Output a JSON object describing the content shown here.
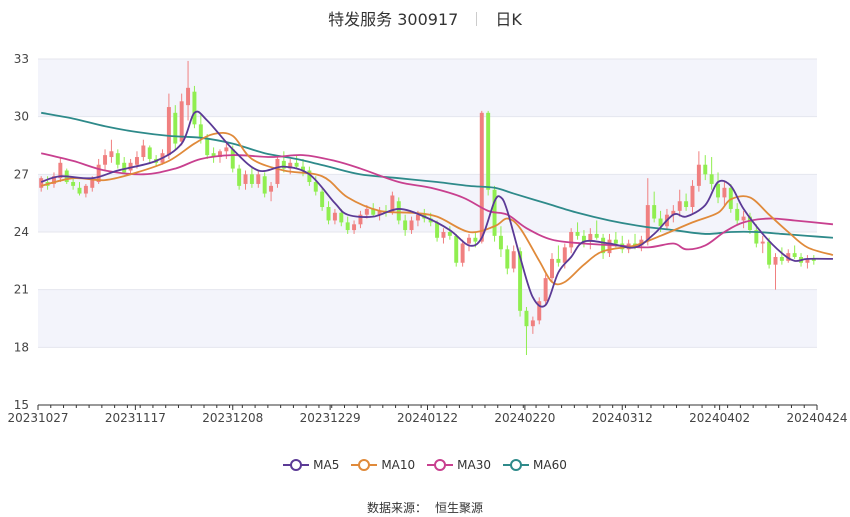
{
  "header": {
    "title": "特发服务 300917",
    "period": "日K"
  },
  "source": {
    "label": "数据来源：",
    "value": "恒生聚源"
  },
  "chart_data": {
    "type": "candlestick",
    "ylim": [
      15,
      33
    ],
    "yticks": [
      15,
      18,
      21,
      24,
      27,
      30,
      33
    ],
    "grid": true,
    "up_color": "#f08080",
    "down_color": "#90ee50",
    "x_tick_labels": [
      "20231027",
      "20231117",
      "20231208",
      "20231229",
      "20240122",
      "20240220",
      "20240312",
      "20240402",
      "20240424"
    ],
    "legend": [
      {
        "name": "MA5",
        "color": "#5b3a96"
      },
      {
        "name": "MA10",
        "color": "#e08a3a"
      },
      {
        "name": "MA30",
        "color": "#c8408f"
      },
      {
        "name": "MA60",
        "color": "#2e8a8a"
      }
    ],
    "ohlc": [
      [
        26.3,
        26.9,
        26.1,
        26.8
      ],
      [
        26.6,
        26.9,
        26.2,
        26.4
      ],
      [
        26.5,
        27.1,
        26.3,
        26.9
      ],
      [
        26.8,
        27.9,
        26.6,
        27.6
      ],
      [
        27.2,
        27.3,
        26.5,
        26.6
      ],
      [
        26.6,
        26.8,
        26.2,
        26.4
      ],
      [
        26.3,
        26.6,
        25.9,
        26.0
      ],
      [
        26.0,
        26.5,
        25.8,
        26.4
      ],
      [
        26.3,
        26.9,
        26.1,
        26.7
      ],
      [
        26.6,
        27.8,
        26.5,
        27.5
      ],
      [
        27.5,
        28.3,
        27.2,
        28.0
      ],
      [
        27.9,
        28.8,
        27.6,
        28.2
      ],
      [
        28.1,
        28.3,
        27.3,
        27.5
      ],
      [
        27.6,
        27.9,
        27.0,
        27.1
      ],
      [
        27.2,
        27.8,
        27.0,
        27.6
      ],
      [
        27.5,
        28.2,
        27.3,
        27.9
      ],
      [
        27.9,
        28.8,
        27.7,
        28.5
      ],
      [
        28.4,
        28.5,
        27.6,
        27.8
      ],
      [
        27.8,
        28.0,
        27.4,
        27.6
      ],
      [
        27.6,
        28.3,
        27.5,
        28.1
      ],
      [
        28.0,
        31.2,
        27.8,
        30.5
      ],
      [
        30.2,
        30.6,
        28.3,
        28.6
      ],
      [
        28.7,
        31.2,
        28.5,
        30.8
      ],
      [
        30.6,
        32.9,
        29.8,
        31.5
      ],
      [
        31.3,
        31.6,
        29.4,
        29.6
      ],
      [
        29.6,
        30.1,
        28.6,
        28.9
      ],
      [
        28.9,
        29.1,
        27.8,
        28.0
      ],
      [
        28.1,
        28.4,
        27.6,
        27.9
      ],
      [
        27.9,
        28.3,
        27.6,
        28.2
      ],
      [
        28.2,
        28.6,
        27.8,
        28.4
      ],
      [
        28.3,
        28.5,
        27.1,
        27.3
      ],
      [
        27.3,
        27.5,
        26.2,
        26.4
      ],
      [
        26.5,
        27.2,
        26.2,
        27.0
      ],
      [
        27.0,
        27.4,
        26.3,
        26.5
      ],
      [
        26.5,
        27.2,
        26.3,
        27.0
      ],
      [
        26.9,
        27.1,
        25.8,
        26.0
      ],
      [
        26.1,
        26.6,
        25.6,
        26.4
      ],
      [
        26.5,
        28.0,
        26.3,
        27.8
      ],
      [
        27.7,
        28.2,
        27.1,
        27.3
      ],
      [
        27.3,
        27.8,
        27.0,
        27.6
      ],
      [
        27.6,
        28.0,
        27.3,
        27.4
      ],
      [
        27.4,
        27.8,
        26.9,
        27.2
      ],
      [
        27.2,
        27.4,
        26.4,
        26.6
      ],
      [
        26.6,
        26.9,
        25.9,
        26.1
      ],
      [
        26.1,
        26.3,
        25.1,
        25.3
      ],
      [
        25.3,
        25.6,
        24.4,
        24.6
      ],
      [
        24.6,
        25.2,
        24.4,
        25.0
      ],
      [
        25.0,
        25.2,
        24.3,
        24.5
      ],
      [
        24.5,
        24.8,
        23.9,
        24.1
      ],
      [
        24.1,
        24.6,
        23.9,
        24.4
      ],
      [
        24.4,
        25.1,
        24.2,
        24.9
      ],
      [
        24.9,
        25.4,
        24.7,
        25.2
      ],
      [
        25.2,
        25.5,
        24.8,
        24.9
      ],
      [
        24.9,
        25.3,
        24.6,
        25.1
      ],
      [
        25.1,
        25.4,
        24.8,
        25.0
      ],
      [
        25.0,
        26.1,
        24.9,
        25.9
      ],
      [
        25.6,
        25.8,
        24.4,
        24.6
      ],
      [
        24.6,
        24.9,
        23.8,
        24.1
      ],
      [
        24.1,
        24.8,
        23.9,
        24.6
      ],
      [
        24.6,
        25.1,
        24.3,
        24.9
      ],
      [
        24.9,
        25.2,
        24.5,
        24.7
      ],
      [
        24.7,
        25.0,
        24.3,
        24.5
      ],
      [
        24.5,
        24.6,
        23.5,
        23.7
      ],
      [
        23.7,
        24.2,
        23.4,
        24.0
      ],
      [
        24.0,
        24.3,
        23.6,
        23.8
      ],
      [
        23.8,
        23.9,
        22.2,
        22.4
      ],
      [
        22.4,
        23.6,
        22.2,
        23.4
      ],
      [
        23.4,
        23.9,
        23.0,
        23.7
      ],
      [
        23.7,
        24.0,
        23.2,
        23.5
      ],
      [
        23.5,
        30.3,
        23.4,
        30.2
      ],
      [
        30.2,
        30.3,
        25.9,
        26.2
      ],
      [
        26.2,
        26.4,
        23.5,
        23.8
      ],
      [
        23.8,
        24.3,
        22.7,
        23.1
      ],
      [
        23.1,
        23.3,
        21.8,
        22.1
      ],
      [
        22.1,
        23.3,
        21.9,
        23.0
      ],
      [
        23.0,
        23.2,
        19.6,
        19.9
      ],
      [
        19.9,
        20.1,
        17.6,
        19.1
      ],
      [
        19.1,
        19.6,
        18.7,
        19.4
      ],
      [
        19.4,
        20.6,
        19.2,
        20.4
      ],
      [
        20.4,
        21.8,
        20.2,
        21.6
      ],
      [
        21.6,
        22.9,
        21.4,
        22.6
      ],
      [
        22.6,
        23.3,
        22.2,
        22.4
      ],
      [
        22.4,
        23.4,
        22.1,
        23.2
      ],
      [
        23.2,
        24.2,
        22.9,
        24.0
      ],
      [
        24.0,
        24.5,
        23.6,
        23.8
      ],
      [
        23.8,
        24.1,
        23.2,
        23.5
      ],
      [
        23.5,
        24.2,
        23.1,
        23.9
      ],
      [
        23.9,
        24.6,
        23.6,
        23.7
      ],
      [
        23.7,
        23.9,
        22.6,
        22.9
      ],
      [
        22.9,
        23.9,
        22.7,
        23.6
      ],
      [
        23.6,
        24.0,
        23.2,
        23.4
      ],
      [
        23.4,
        23.8,
        22.9,
        23.1
      ],
      [
        23.1,
        23.6,
        22.9,
        23.4
      ],
      [
        23.4,
        23.9,
        23.1,
        23.3
      ],
      [
        23.3,
        23.8,
        23.0,
        23.6
      ],
      [
        23.6,
        26.8,
        23.3,
        25.4
      ],
      [
        25.4,
        26.1,
        24.5,
        24.7
      ],
      [
        24.7,
        25.1,
        24.0,
        24.3
      ],
      [
        24.3,
        25.2,
        24.1,
        24.9
      ],
      [
        24.9,
        25.4,
        24.5,
        25.1
      ],
      [
        25.1,
        26.2,
        24.8,
        25.6
      ],
      [
        25.6,
        26.0,
        25.1,
        25.3
      ],
      [
        25.3,
        26.7,
        25.0,
        26.4
      ],
      [
        26.4,
        28.2,
        26.1,
        27.5
      ],
      [
        27.5,
        28.0,
        26.7,
        27.0
      ],
      [
        27.0,
        27.9,
        26.2,
        26.5
      ],
      [
        26.5,
        27.1,
        25.5,
        25.8
      ],
      [
        25.8,
        26.6,
        25.4,
        26.3
      ],
      [
        26.3,
        26.5,
        25.0,
        25.2
      ],
      [
        25.2,
        25.5,
        24.4,
        24.6
      ],
      [
        24.6,
        25.1,
        24.2,
        24.8
      ],
      [
        24.8,
        25.0,
        23.9,
        24.1
      ],
      [
        24.1,
        24.4,
        23.2,
        23.4
      ],
      [
        23.4,
        23.8,
        22.9,
        23.5
      ],
      [
        23.5,
        23.7,
        22.1,
        22.3
      ],
      [
        22.3,
        22.9,
        21.0,
        22.7
      ],
      [
        22.7,
        23.2,
        22.3,
        22.5
      ],
      [
        22.5,
        23.1,
        22.4,
        22.9
      ],
      [
        22.9,
        23.3,
        22.6,
        22.7
      ],
      [
        22.7,
        22.9,
        22.2,
        22.4
      ],
      [
        22.4,
        22.8,
        22.1,
        22.6
      ],
      [
        22.6,
        22.8,
        22.3,
        22.5
      ]
    ],
    "ma": {
      "MA5": [
        [
          0,
          26.6
        ],
        [
          3,
          26.9
        ],
        [
          8,
          26.8
        ],
        [
          12,
          27.2
        ],
        [
          18,
          27.7
        ],
        [
          22,
          28.6
        ],
        [
          24,
          30.2
        ],
        [
          26,
          29.8
        ],
        [
          30,
          28.3
        ],
        [
          34,
          27.2
        ],
        [
          38,
          27.4
        ],
        [
          42,
          27.0
        ],
        [
          46,
          25.5
        ],
        [
          48,
          24.9
        ],
        [
          52,
          24.8
        ],
        [
          56,
          25.2
        ],
        [
          60,
          24.8
        ],
        [
          64,
          24.1
        ],
        [
          67,
          23.3
        ],
        [
          69,
          23.7
        ],
        [
          71,
          25.6
        ],
        [
          72,
          25.8
        ],
        [
          73,
          25.1
        ],
        [
          75,
          22.7
        ],
        [
          77,
          20.6
        ],
        [
          79,
          20.2
        ],
        [
          81,
          21.9
        ],
        [
          83,
          22.7
        ],
        [
          85,
          23.5
        ],
        [
          89,
          23.4
        ],
        [
          93,
          23.2
        ],
        [
          96,
          23.9
        ],
        [
          99,
          24.9
        ],
        [
          101,
          24.8
        ],
        [
          104,
          25.4
        ],
        [
          106,
          26.6
        ],
        [
          108,
          26.4
        ],
        [
          110,
          25.2
        ],
        [
          113,
          23.9
        ],
        [
          116,
          22.9
        ],
        [
          118,
          22.5
        ],
        [
          120,
          22.6
        ],
        [
          124,
          22.6
        ]
      ],
      "MA10": [
        [
          0,
          26.4
        ],
        [
          5,
          26.8
        ],
        [
          10,
          26.7
        ],
        [
          15,
          27.1
        ],
        [
          20,
          27.7
        ],
        [
          24,
          28.6
        ],
        [
          27,
          29.1
        ],
        [
          30,
          29.0
        ],
        [
          33,
          27.8
        ],
        [
          38,
          27.2
        ],
        [
          44,
          26.9
        ],
        [
          48,
          25.8
        ],
        [
          53,
          25.1
        ],
        [
          58,
          25.0
        ],
        [
          62,
          24.8
        ],
        [
          67,
          24.0
        ],
        [
          71,
          24.3
        ],
        [
          73,
          24.7
        ],
        [
          75,
          24.2
        ],
        [
          78,
          22.5
        ],
        [
          80,
          21.4
        ],
        [
          82,
          21.4
        ],
        [
          85,
          22.3
        ],
        [
          88,
          23.0
        ],
        [
          93,
          23.3
        ],
        [
          97,
          23.8
        ],
        [
          102,
          24.5
        ],
        [
          106,
          25.0
        ],
        [
          108,
          25.7
        ],
        [
          111,
          25.8
        ],
        [
          114,
          24.9
        ],
        [
          117,
          24.0
        ],
        [
          120,
          23.2
        ],
        [
          124,
          22.8
        ]
      ],
      "MA30": [
        [
          0,
          28.1
        ],
        [
          5,
          27.7
        ],
        [
          10,
          27.2
        ],
        [
          16,
          27.0
        ],
        [
          21,
          27.3
        ],
        [
          25,
          27.8
        ],
        [
          30,
          28.0
        ],
        [
          36,
          27.9
        ],
        [
          41,
          28.0
        ],
        [
          46,
          27.7
        ],
        [
          50,
          27.3
        ],
        [
          56,
          26.6
        ],
        [
          61,
          26.3
        ],
        [
          66,
          25.8
        ],
        [
          70,
          25.1
        ],
        [
          73,
          24.9
        ],
        [
          76,
          24.2
        ],
        [
          80,
          23.6
        ],
        [
          85,
          23.4
        ],
        [
          90,
          23.3
        ],
        [
          95,
          23.2
        ],
        [
          99,
          23.4
        ],
        [
          101,
          23.1
        ],
        [
          104,
          23.3
        ],
        [
          107,
          24.0
        ],
        [
          110,
          24.5
        ],
        [
          114,
          24.7
        ],
        [
          118,
          24.6
        ],
        [
          124,
          24.4
        ]
      ],
      "MA60": [
        [
          0,
          30.2
        ],
        [
          5,
          29.9
        ],
        [
          10,
          29.5
        ],
        [
          15,
          29.2
        ],
        [
          20,
          29.0
        ],
        [
          25,
          28.9
        ],
        [
          30,
          28.6
        ],
        [
          35,
          28.1
        ],
        [
          40,
          27.8
        ],
        [
          45,
          27.4
        ],
        [
          50,
          27.0
        ],
        [
          56,
          26.8
        ],
        [
          62,
          26.6
        ],
        [
          67,
          26.4
        ],
        [
          71,
          26.3
        ],
        [
          74,
          26.0
        ],
        [
          79,
          25.5
        ],
        [
          84,
          25.0
        ],
        [
          89,
          24.6
        ],
        [
          94,
          24.3
        ],
        [
          99,
          24.1
        ],
        [
          104,
          23.9
        ],
        [
          108,
          24.0
        ],
        [
          112,
          24.0
        ],
        [
          116,
          23.9
        ],
        [
          120,
          23.8
        ],
        [
          124,
          23.7
        ]
      ]
    }
  }
}
